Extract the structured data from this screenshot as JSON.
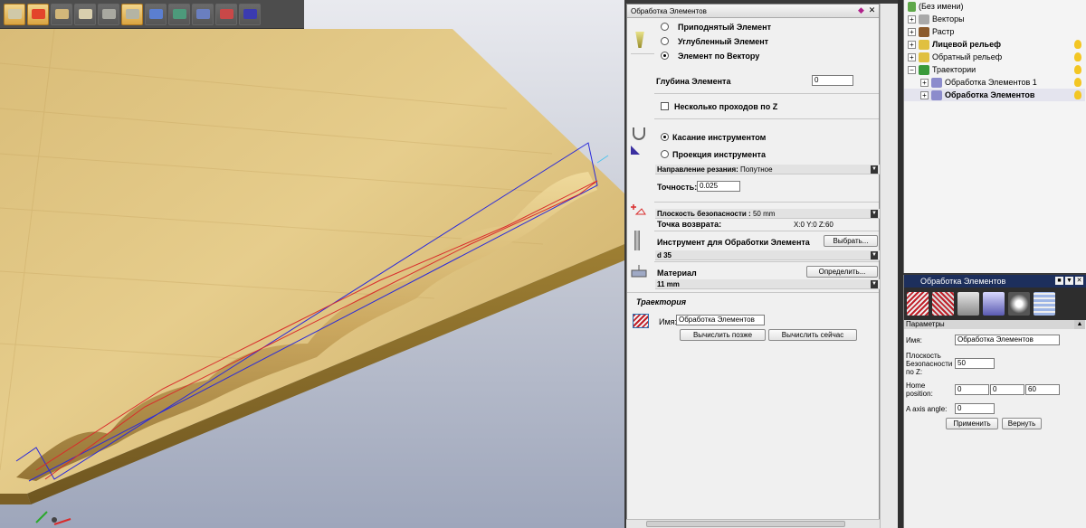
{
  "toolbar": {
    "buttons": [
      {
        "name": "transform-tool-icon",
        "color": "#d0c9a8",
        "active": true
      },
      {
        "name": "axis-tool-icon",
        "color": "#e3442b",
        "active": true
      },
      {
        "name": "block-relief-icon",
        "color": "#d2b77a",
        "active": false
      },
      {
        "name": "bevel-icon",
        "color": "#d9cfae",
        "active": false
      },
      {
        "name": "flat-area-icon",
        "color": "#a8a8a0",
        "active": false
      },
      {
        "name": "feature-machining-icon",
        "color": "#b4b4a4",
        "active": true
      },
      {
        "name": "paint-brush-icon",
        "color": "#5b7fd1",
        "active": false
      },
      {
        "name": "paint-fill-icon",
        "color": "#4d9a7b",
        "active": false
      },
      {
        "name": "shaded-view-icon",
        "color": "#6a7fc0",
        "active": false
      },
      {
        "name": "color-view-icon",
        "color": "#c94848",
        "active": false
      },
      {
        "name": "render-view-icon",
        "color": "#3b3bb0",
        "active": false
      }
    ]
  },
  "panel": {
    "title": "Обработка Элементов",
    "mode": {
      "raised": "Приподнятый Элемент",
      "sunken": "Углубленный Элемент",
      "along_vector": "Элемент по Вектору"
    },
    "depth_label": "Глубина Элемента",
    "depth_value": "0",
    "multi_pass_label": "Несколько проходов по Z",
    "tool_contact": "Касание инструментом",
    "tool_projection": "Проекция инструмента",
    "cut_dir_label": "Направление резания:",
    "cut_dir_value": "Попутное",
    "tolerance_label": "Точность:",
    "tolerance_value": "0.025",
    "safe_z_label": "Плоскость безопасности :",
    "safe_z_value": "50 mm",
    "home_label": "Точка возврата:",
    "home_value": "X:0 Y:0 Z:60",
    "tool_label": "Инструмент для Обработки Элемента",
    "tool_select_btn": "Выбрать...",
    "tool_value": "d 35",
    "material_label": "Материал",
    "material_btn": "Определить...",
    "material_value": "11 mm",
    "trajectory_section": "Траектория",
    "name_label": "Имя:",
    "name_value": "Обработка Элементов",
    "calc_later_btn": "Вычислить позже",
    "calc_now_btn": "Вычислить сейчас"
  },
  "tree": {
    "root": "(Без имени)",
    "items": [
      {
        "label": "Векторы",
        "bold": false,
        "expander": "+",
        "icon": "vectors-icon",
        "color": "#a9a9a9",
        "indent": 0
      },
      {
        "label": "Растр",
        "bold": false,
        "expander": "+",
        "icon": "raster-icon",
        "color": "#8b5a2b",
        "indent": 0
      },
      {
        "label": "Лицевой рельеф",
        "bold": true,
        "expander": "+",
        "icon": "front-relief-icon",
        "color": "#e0c040",
        "indent": 0
      },
      {
        "label": "Обратный рельеф",
        "bold": false,
        "expander": "+",
        "icon": "back-relief-icon",
        "color": "#e0c040",
        "indent": 0
      },
      {
        "label": "Траектории",
        "bold": false,
        "expander": "−",
        "icon": "toolpaths-icon",
        "color": "#3a9a3a",
        "indent": 0
      },
      {
        "label": "Обработка Элементов 1",
        "bold": false,
        "expander": "+",
        "icon": "toolpath-icon",
        "color": "#8c8ccc",
        "indent": 1
      },
      {
        "label": "Обработка Элементов",
        "bold": true,
        "expander": "+",
        "icon": "toolpath-icon",
        "color": "#8c8ccc",
        "indent": 1
      }
    ]
  },
  "params": {
    "title": "Обработка Элементов",
    "section": "Параметры",
    "name_label": "Имя:",
    "name_value": "Обработка Элементов",
    "safe_label_1": "Плоскость",
    "safe_label_2": "Безопасности",
    "safe_label_3": "по Z:",
    "safe_value": "50",
    "home_label_1": "Home",
    "home_label_2": "position:",
    "home_x": "0",
    "home_y": "0",
    "home_z": "60",
    "axis_label": "A axis angle:",
    "axis_value": "0",
    "apply_btn": "Применить",
    "revert_btn": "Вернуть"
  },
  "colors": {
    "wood": "#d6b872",
    "toolpath_blue": "#2b2bd9",
    "toolpath_red": "#d92b2b",
    "title_bar": "#1d2f5c"
  }
}
